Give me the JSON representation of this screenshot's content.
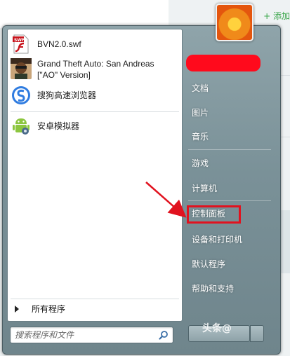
{
  "background": {
    "add_label": "+ 添加",
    "accent": "#3aa64a"
  },
  "programs": [
    {
      "name": "BVN2.0.swf",
      "icon": "flash-file-icon"
    },
    {
      "name": "Grand Theft Auto: San Andreas [\"AO\" Version]",
      "icon": "gta-sa-icon"
    },
    {
      "name": "搜狗高速浏览器",
      "icon": "sogou-browser-icon"
    },
    {
      "name": "安卓模拟器",
      "icon": "android-emulator-icon"
    }
  ],
  "all_programs_label": "所有程序",
  "search": {
    "placeholder": "搜索程序和文件"
  },
  "right_items": [
    {
      "label": "文档"
    },
    {
      "label": "图片"
    },
    {
      "label": "音乐"
    },
    {
      "label": "游戏"
    },
    {
      "label": "计算机"
    },
    {
      "label": "控制面板"
    },
    {
      "label": "设备和打印机"
    },
    {
      "label": "默认程序"
    },
    {
      "label": "帮助和支持"
    }
  ],
  "highlight_color": "#e1121f",
  "watermark": "头条@"
}
